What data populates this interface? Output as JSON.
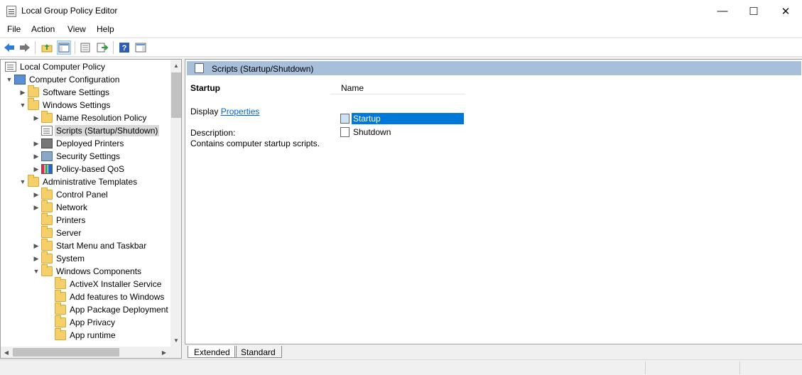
{
  "window": {
    "title": "Local Group Policy Editor"
  },
  "menu": [
    "File",
    "Action",
    "View",
    "Help"
  ],
  "toolbar": {
    "icons": [
      "back-arrow-icon",
      "forward-arrow-icon",
      "up-folder-icon",
      "show-hide-tree-icon",
      "properties-icon",
      "export-list-icon",
      "help-icon",
      "show-hide-action-pane-icon"
    ]
  },
  "tree": {
    "items": [
      {
        "label": "Local Computer Policy",
        "expander": "",
        "icon": "doc"
      },
      {
        "label": "Computer Configuration",
        "expander": "▼",
        "icon": "pc"
      },
      {
        "label": "Software Settings",
        "expander": "▶",
        "icon": "folder"
      },
      {
        "label": "Windows Settings",
        "expander": "▼",
        "icon": "folder"
      },
      {
        "label": "Name Resolution Policy",
        "expander": "▶",
        "icon": "folder"
      },
      {
        "label": "Scripts (Startup/Shutdown)",
        "expander": "",
        "icon": "doc"
      },
      {
        "label": "Deployed Printers",
        "expander": "▶",
        "icon": "printer"
      },
      {
        "label": "Security Settings",
        "expander": "▶",
        "icon": "shield"
      },
      {
        "label": "Policy-based QoS",
        "expander": "▶",
        "icon": "qos"
      },
      {
        "label": "Administrative Templates",
        "expander": "▼",
        "icon": "folder"
      },
      {
        "label": "Control Panel",
        "expander": "▶",
        "icon": "folder"
      },
      {
        "label": "Network",
        "expander": "▶",
        "icon": "folder"
      },
      {
        "label": "Printers",
        "expander": "",
        "icon": "folder"
      },
      {
        "label": "Server",
        "expander": "",
        "icon": "folder"
      },
      {
        "label": "Start Menu and Taskbar",
        "expander": "▶",
        "icon": "folder"
      },
      {
        "label": "System",
        "expander": "▶",
        "icon": "folder"
      },
      {
        "label": "Windows Components",
        "expander": "▼",
        "icon": "folder"
      },
      {
        "label": "ActiveX Installer Service",
        "expander": "",
        "icon": "folder"
      },
      {
        "label": "Add features to Windows",
        "expander": "",
        "icon": "folder"
      },
      {
        "label": "App Package Deployment",
        "expander": "",
        "icon": "folder"
      },
      {
        "label": "App Privacy",
        "expander": "",
        "icon": "folder"
      },
      {
        "label": "App runtime",
        "expander": "",
        "icon": "folder"
      }
    ]
  },
  "content": {
    "header_title": "Scripts (Startup/Shutdown)",
    "item_title": "Startup",
    "display_prefix": "Display",
    "properties_link": "Properties",
    "description_label": "Description:",
    "description_text": "Contains computer startup scripts.",
    "list_header": "Name",
    "list_items": [
      "Startup",
      "Shutdown"
    ]
  },
  "tabs": [
    "Extended",
    "Standard"
  ]
}
